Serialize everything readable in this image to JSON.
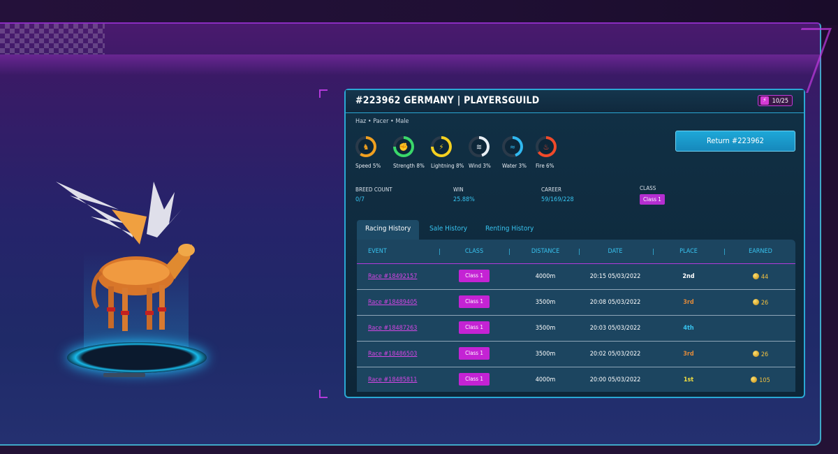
{
  "panel": {
    "title": "#223962 GERMANY | PLAYERSGUILD",
    "energy": "10/25",
    "energy_icon": "lightning-icon",
    "traits": "Haz  •  Pacer  •  Male",
    "return_button": "Return #223962"
  },
  "stats": [
    {
      "label": "Speed  5%",
      "icon": "horse-icon",
      "color": "#f0a020",
      "pct": 0.05
    },
    {
      "label": "Strength  8%",
      "icon": "fist-icon",
      "color": "#3ad86a",
      "pct": 0.08
    },
    {
      "label": "Lightning  8%",
      "icon": "lightning-icon",
      "color": "#f4d020",
      "pct": 0.08
    },
    {
      "label": "Wind  3%",
      "icon": "wind-icon",
      "color": "#e8eef4",
      "pct": 0.03
    },
    {
      "label": "Water  3%",
      "icon": "water-icon",
      "color": "#30b8f0",
      "pct": 0.03
    },
    {
      "label": "Fire  6%",
      "icon": "fire-icon",
      "color": "#f04a2a",
      "pct": 0.06
    }
  ],
  "info": {
    "breed_label": "BREED COUNT",
    "breed_value": "0/7",
    "win_label": "WIN",
    "win_value": "25.88%",
    "career_label": "CAREER",
    "career_value": "59/169/228",
    "class_label": "CLASS",
    "class_value": "Class 1"
  },
  "tabs": [
    "Racing History",
    "Sale History",
    "Renting History"
  ],
  "table": {
    "headers": [
      "EVENT",
      "CLASS",
      "DISTANCE",
      "DATE",
      "PLACE",
      "EARNED"
    ],
    "rows": [
      {
        "event": "Race #18492157",
        "class": "Class 1",
        "distance": "4000m",
        "date": "20:15 05/03/2022",
        "place": "2nd",
        "place_color": "#ffffff",
        "earned": "44"
      },
      {
        "event": "Race #18489405",
        "class": "Class 1",
        "distance": "3500m",
        "date": "20:08 05/03/2022",
        "place": "3rd",
        "place_color": "#e08a3a",
        "earned": "26"
      },
      {
        "event": "Race #18487263",
        "class": "Class 1",
        "distance": "3500m",
        "date": "20:03 05/03/2022",
        "place": "4th",
        "place_color": "#38c4f0",
        "earned": ""
      },
      {
        "event": "Race #18486503",
        "class": "Class 1",
        "distance": "3500m",
        "date": "20:02 05/03/2022",
        "place": "3rd",
        "place_color": "#e08a3a",
        "earned": "26"
      },
      {
        "event": "Race #18485811",
        "class": "Class 1",
        "distance": "4000m",
        "date": "20:00 05/03/2022",
        "place": "1st",
        "place_color": "#f4e040",
        "earned": "105"
      }
    ]
  }
}
